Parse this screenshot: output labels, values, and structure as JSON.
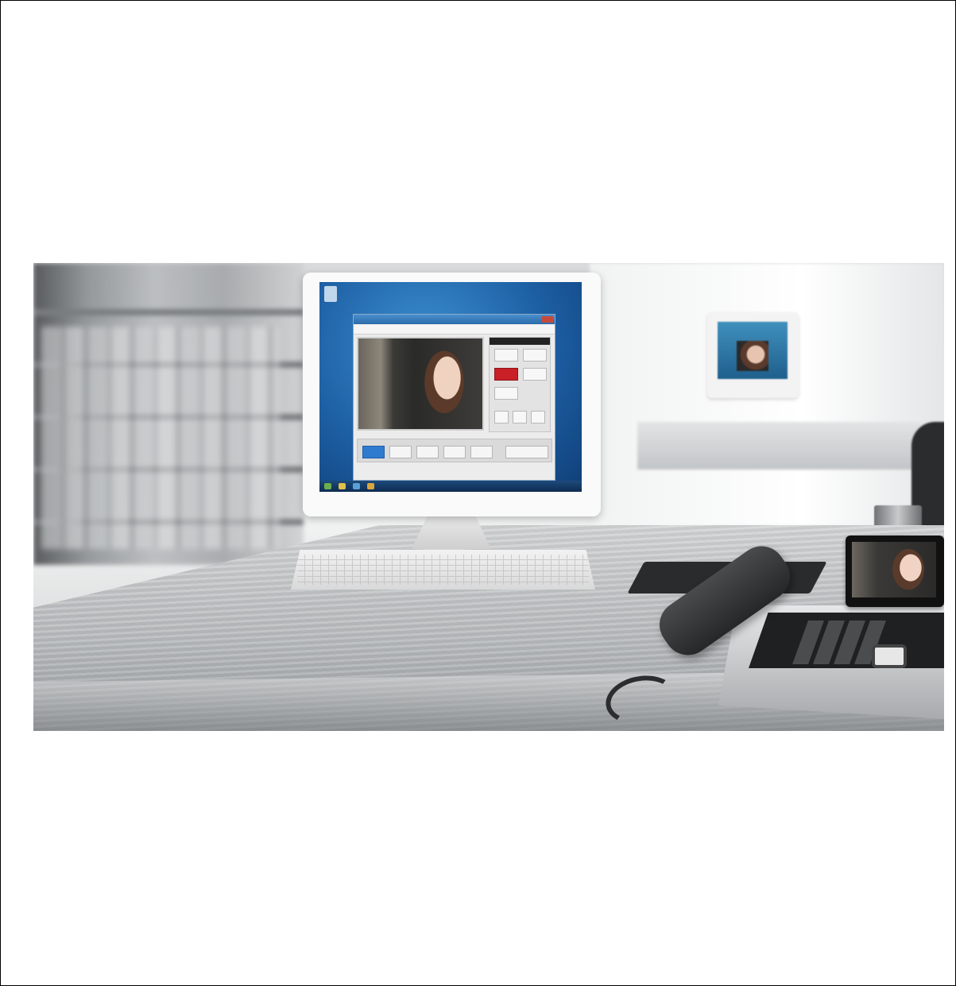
{
  "photo": {
    "subject": "office-desk-scene",
    "colors": {
      "page_background": "#ffffff",
      "screen_blue": "#1d5fa3",
      "app_red_button": "#c91f26",
      "app_blue_button": "#2f7bd0",
      "handset": "#2a2b2c"
    },
    "icons": [
      "monitor-icon",
      "keyboard-icon",
      "phone-icon"
    ]
  }
}
